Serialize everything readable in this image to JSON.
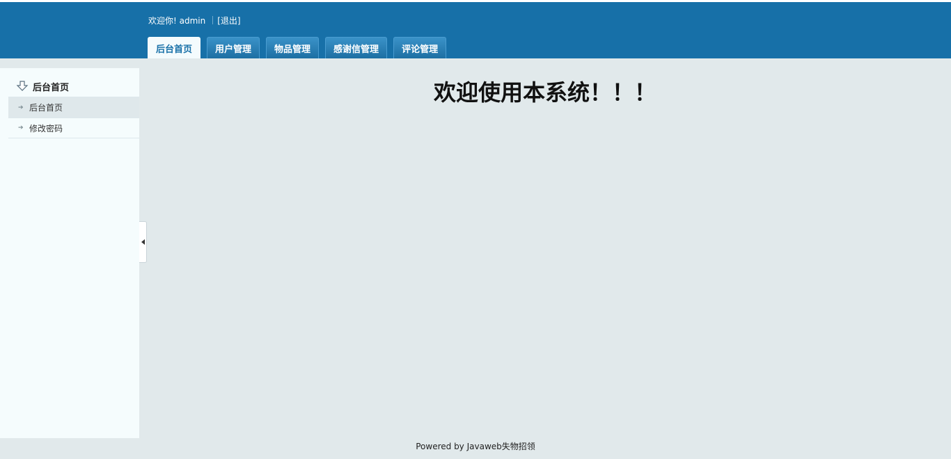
{
  "header": {
    "welcome_text": "欢迎你!  admin",
    "logout_label": "[退出]",
    "tabs": [
      {
        "label": "后台首页",
        "active": true
      },
      {
        "label": "用户管理",
        "active": false
      },
      {
        "label": "物品管理",
        "active": false
      },
      {
        "label": "感谢信管理",
        "active": false
      },
      {
        "label": "评论管理",
        "active": false
      }
    ]
  },
  "sidebar": {
    "title": "后台首页",
    "title_icon": "down-arrow-icon",
    "items": [
      {
        "label": "后台首页",
        "active": true,
        "icon": "arrow-right-icon"
      },
      {
        "label": "修改密码",
        "active": false,
        "icon": "arrow-right-icon"
      }
    ],
    "collapse_icon": "triangle-left-icon"
  },
  "main": {
    "heading": "欢迎使用本系统！！！"
  },
  "footer": {
    "text": "Powered by Javaweb失物招领"
  },
  "colors": {
    "header_bg": "#1770a8",
    "page_bg": "#e1e9eb",
    "sidebar_bg": "#f5fcfd",
    "active_tab_text": "#1770a8"
  }
}
